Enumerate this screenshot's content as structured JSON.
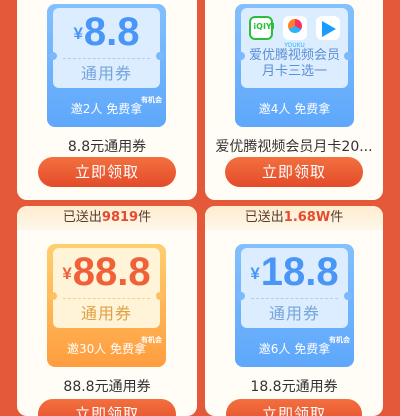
{
  "cards": [
    {
      "amount": "8.8",
      "currency": "¥",
      "coupon_type": "通用券",
      "invite": "邀2人 免费拿",
      "tag": "有机会",
      "desc": "8.8元通用券",
      "button": "立即领取"
    },
    {
      "logos": [
        "iqiyi-icon",
        "youku-icon",
        "tencent-video-icon"
      ],
      "logo_text": {
        "iqiyi": "iQIYI",
        "youku": "YOUKU"
      },
      "member_line1": "爱优腾视频会员",
      "member_line2": "月卡三选一",
      "invite": "邀4人 免费拿",
      "desc": "爱优腾视频会员月卡20...",
      "button": "立即领取"
    },
    {
      "sent_prefix": "已送出",
      "sent_count": "9819",
      "sent_suffix": "件",
      "amount": "88.8",
      "currency": "¥",
      "coupon_type": "通用券",
      "invite": "邀30人 免费拿",
      "tag": "有机会",
      "desc": "88.8元通用券",
      "button": "立即领取"
    },
    {
      "sent_prefix": "已送出",
      "sent_count": "1.68W",
      "sent_suffix": "件",
      "amount": "18.8",
      "currency": "¥",
      "coupon_type": "通用券",
      "invite": "邀6人 免费拿",
      "tag": "有机会",
      "desc": "18.8元通用券",
      "button": "立即领取"
    }
  ],
  "colors": {
    "background": "#e4593a",
    "button": "#e34b2a",
    "blue_coupon": "#5ea7fb",
    "orange_coupon": "#ff9d3f"
  }
}
